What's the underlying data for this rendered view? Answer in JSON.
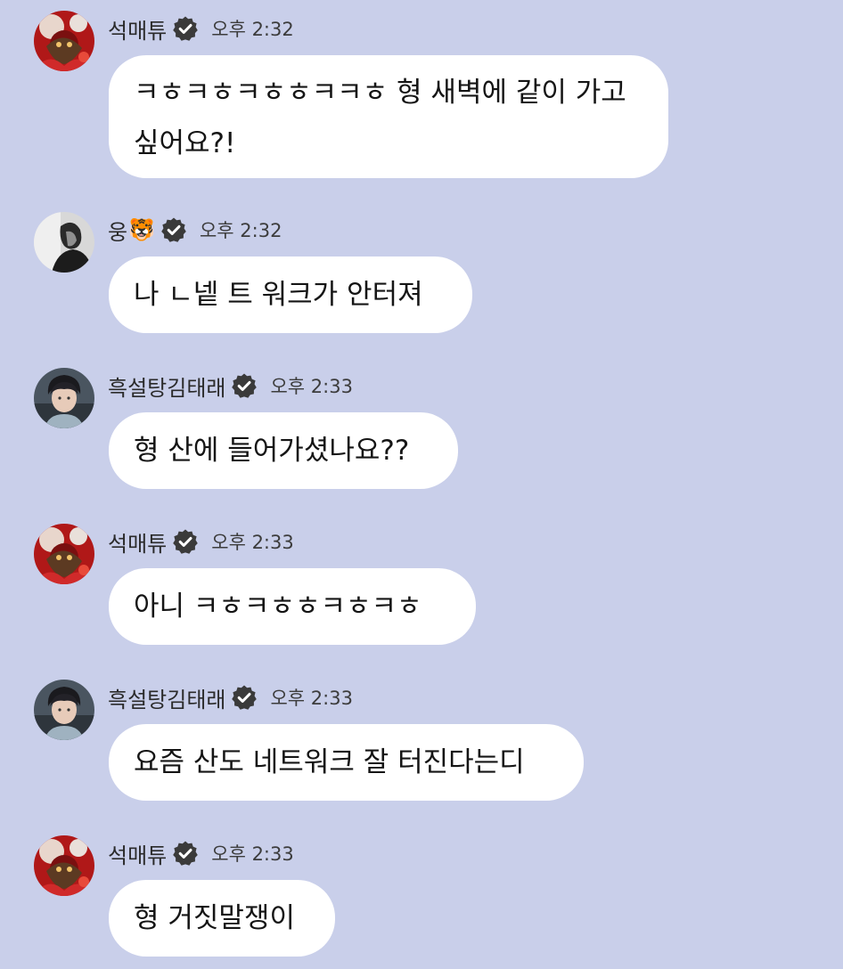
{
  "messages": [
    {
      "sender": "석매튜",
      "time": "오후 2:32",
      "text": "ㅋㅎㅋㅎㅋㅎㅎㅋㅋㅎ 형 새벽에 같이 가고 싶어요?!",
      "avatar": "avatar-red-art"
    },
    {
      "sender": "웅",
      "sender_emoji": "🐯",
      "time": "오후 2:32",
      "text": "나 ㄴ넽 트 워크가 안터져",
      "avatar": "avatar-bw-person"
    },
    {
      "sender": "흑설탕김태래",
      "time": "오후 2:33",
      "text": "형 산에 들어가셨나요??",
      "avatar": "avatar-person-photo"
    },
    {
      "sender": "석매튜",
      "time": "오후 2:33",
      "text": "아니 ㅋㅎㅋㅎㅎㅋㅎㅋㅎ",
      "avatar": "avatar-red-art"
    },
    {
      "sender": "흑설탕김태래",
      "time": "오후 2:33",
      "text": "요즘 산도 네트워크 잘 터진다는디",
      "avatar": "avatar-person-photo"
    },
    {
      "sender": "석매튜",
      "time": "오후 2:33",
      "text": "형 거짓말쟁이",
      "avatar": "avatar-red-art"
    }
  ],
  "icons": {
    "verified": "verified-badge-icon"
  },
  "colors": {
    "background": "#c9cfea",
    "bubble": "#ffffff",
    "badge": "#3a3a3a"
  }
}
